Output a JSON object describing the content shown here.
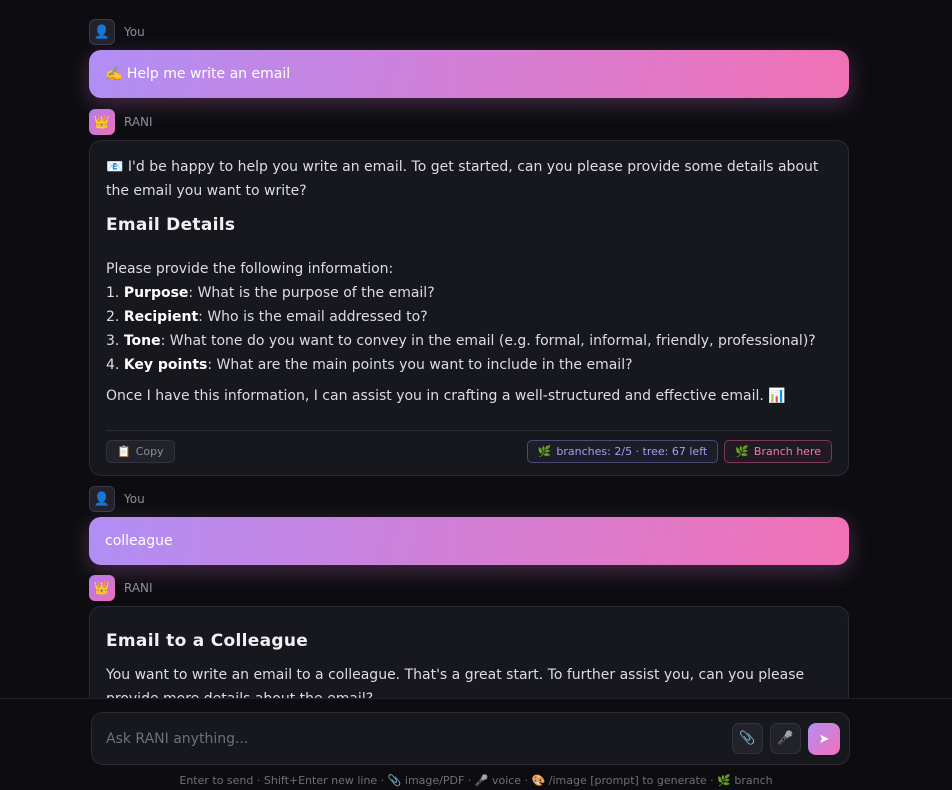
{
  "messages": {
    "m1": {
      "role": "You",
      "text": "✍️ Help me write an email"
    },
    "m2": {
      "role": "RANI",
      "intro": "📧 I'd be happy to help you write an email. To get started, can you please provide some details about the email you want to write?",
      "heading": "Email Details",
      "lead": "Please provide the following information:",
      "items": [
        {
          "num": "1.",
          "term": "Purpose",
          "text": ": What is the purpose of the email?"
        },
        {
          "num": "2.",
          "term": "Recipient",
          "text": ": Who is the email addressed to?"
        },
        {
          "num": "3.",
          "term": "Tone",
          "text": ": What tone do you want to convey in the email (e.g. formal, informal, friendly, professional)?"
        },
        {
          "num": "4.",
          "term": "Key points",
          "text": ": What are the main points you want to include in the email?"
        }
      ],
      "closing": "Once I have this information, I can assist you in crafting a well-structured and effective email. 📊",
      "copy_label": "Copy",
      "branches_label": "branches: 2/5 · tree: 67 left",
      "branch_here_label": "Branch here"
    },
    "m3": {
      "role": "You",
      "text": "colleague"
    },
    "m4": {
      "role": "RANI",
      "heading": "Email to a Colleague",
      "text": "You want to write an email to a colleague. That's a great start. To further assist you, can you please provide more details about the email?"
    }
  },
  "composer": {
    "placeholder": "Ask RANI anything...",
    "hint": "Enter to send · Shift+Enter new line · 📎 image/PDF · 🎤 voice · 🎨 /image [prompt] to generate · 🌿 branch"
  },
  "icons": {
    "user_avatar": "👤",
    "bot_avatar": "👑",
    "copy": "📋",
    "branch": "🌿",
    "attach": "📎",
    "mic": "🎤",
    "send": "➤"
  },
  "colors": {
    "background": "#0d0d11",
    "card": "#17171e",
    "accent_start": "#b08ef5",
    "accent_end": "#f171b5"
  }
}
